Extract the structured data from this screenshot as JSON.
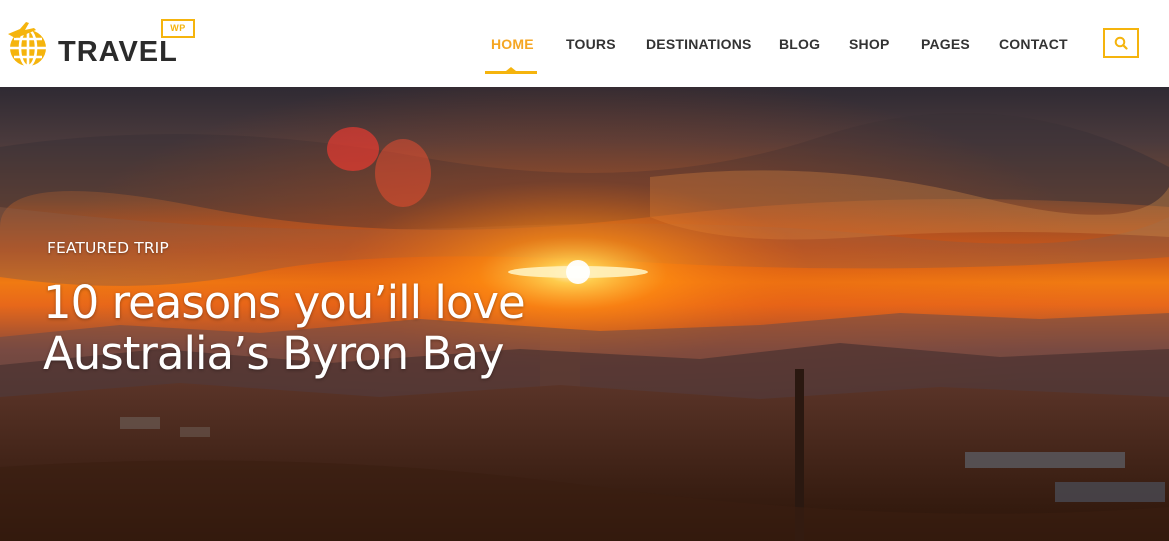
{
  "brand": {
    "name": "TRAVEL",
    "badge": "WP",
    "accent_color": "#f5b40d",
    "icon": "globe-plane-icon"
  },
  "nav": {
    "items": [
      {
        "label": "HOME",
        "active": true
      },
      {
        "label": "TOURS",
        "active": false
      },
      {
        "label": "DESTINATIONS",
        "active": false
      },
      {
        "label": "BLOG",
        "active": false
      },
      {
        "label": "SHOP",
        "active": false
      },
      {
        "label": "PAGES",
        "active": false
      },
      {
        "label": "CONTACT",
        "active": false
      }
    ],
    "search_icon": "search-icon"
  },
  "hero": {
    "eyebrow": "FEATURED TRIP",
    "title_line1": "10 reasons you’ill love",
    "title_line2": "Australia’s Byron Bay"
  }
}
